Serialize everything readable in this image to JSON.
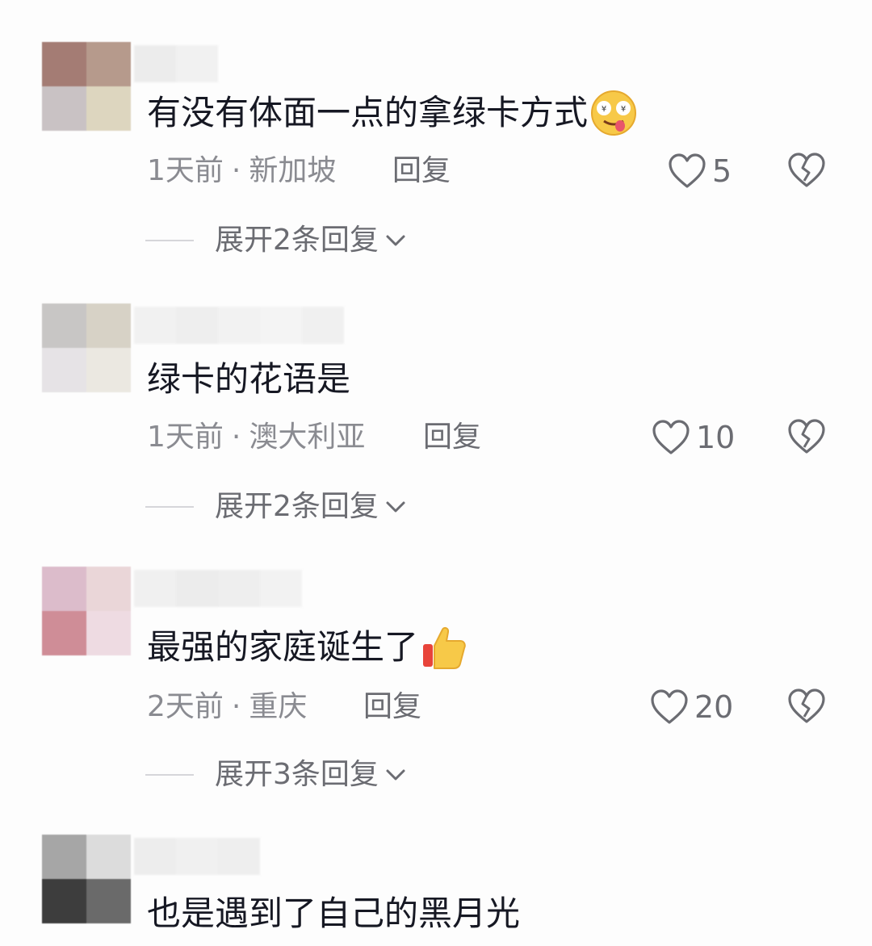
{
  "comments": [
    {
      "text": "有没有体面一点的拿绿卡方式",
      "emoji": "drooling-face-emoji",
      "time": "1天前",
      "location": "新加坡",
      "reply_label": "回复",
      "likes": "5",
      "expand_label": "展开2条回复",
      "avatar_colors": [
        "#a47c74",
        "#b69a8c",
        "#c9c2c4",
        "#ddd6bf"
      ],
      "name_colors": [
        "#ececec",
        "#f1f1f1",
        "#f4f4f4"
      ]
    },
    {
      "text": "绿卡的花语是",
      "emoji": "",
      "time": "1天前",
      "location": "澳大利亚",
      "reply_label": "回复",
      "likes": "10",
      "expand_label": "展开2条回复",
      "avatar_colors": [
        "#c8c6c5",
        "#d7d2c6",
        "#e6e3e6",
        "#ebe8e1"
      ],
      "name_colors": [
        "#f1f1f1",
        "#eeeeee",
        "#f2f2f2",
        "#f4f4f4",
        "#f0f0f0"
      ]
    },
    {
      "text": "最强的家庭诞生了",
      "emoji": "thumbs-up-emoji",
      "time": "2天前",
      "location": "重庆",
      "reply_label": "回复",
      "likes": "20",
      "expand_label": "展开3条回复",
      "avatar_colors": [
        "#dcbccb",
        "#ead6d8",
        "#cf8d97",
        "#eedbe2"
      ],
      "name_colors": [
        "#f0f0f0",
        "#ececec",
        "#eeeeee",
        "#f2f2f2"
      ]
    },
    {
      "text": "也是遇到了自己的黑月光",
      "emoji": "",
      "time": "",
      "location": "",
      "reply_label": "",
      "likes": "",
      "expand_label": "",
      "avatar_colors": [
        "#a6a6a6",
        "#dcdcdc",
        "#3d3d3d",
        "#6a6a6a"
      ],
      "name_colors": [
        "#ededed",
        "#f0f0f0",
        "#eeeeee"
      ]
    }
  ],
  "icons": {
    "like": "heart-outline-icon",
    "dislike": "broken-heart-icon",
    "expand": "chevron-down-icon"
  },
  "colors": {
    "text": "#161823",
    "meta": "#8a8b91",
    "action": "#6b6c72",
    "divider": "#d6d6da"
  }
}
